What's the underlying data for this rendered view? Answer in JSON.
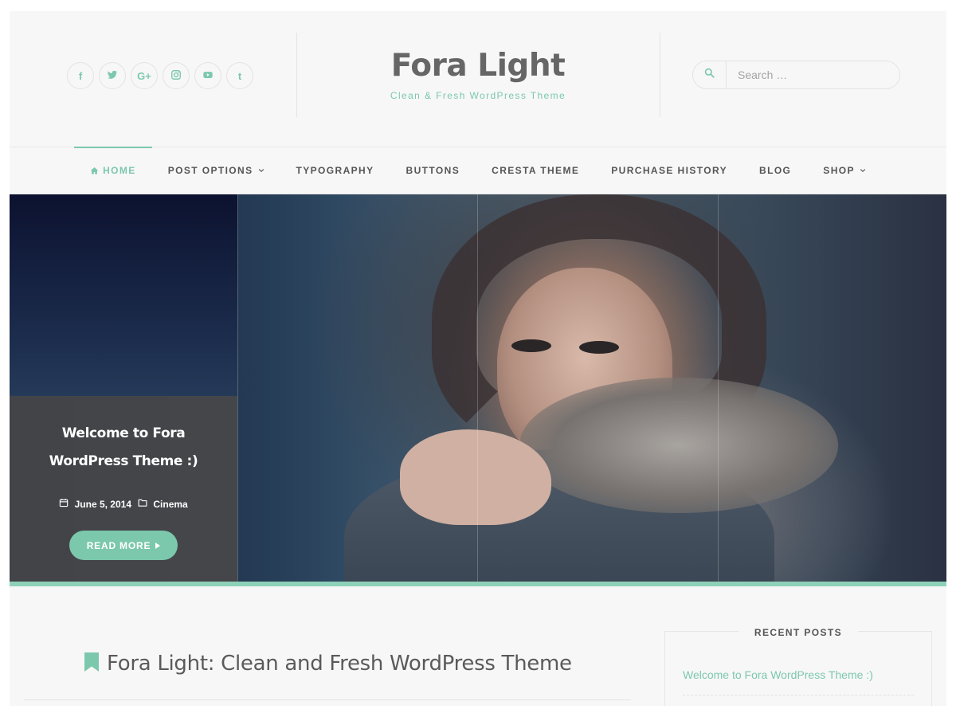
{
  "colors": {
    "accent": "#7cc8ad",
    "text": "#555555",
    "background": "#f7f7f7"
  },
  "header": {
    "social": [
      {
        "name": "facebook",
        "icon": "facebook-icon",
        "glyph": "f"
      },
      {
        "name": "twitter",
        "icon": "twitter-icon",
        "glyph": ""
      },
      {
        "name": "google-plus",
        "icon": "google-plus-icon",
        "glyph": "G+"
      },
      {
        "name": "instagram",
        "icon": "instagram-icon",
        "glyph": ""
      },
      {
        "name": "youtube",
        "icon": "youtube-icon",
        "glyph": ""
      },
      {
        "name": "tumblr",
        "icon": "tumblr-icon",
        "glyph": "t"
      }
    ],
    "site_title": "Fora Light",
    "tagline": "Clean & Fresh WordPress Theme",
    "search_placeholder": "Search …"
  },
  "nav": {
    "items": [
      {
        "label": "HOME",
        "active": true,
        "dropdown": false
      },
      {
        "label": "POST OPTIONS",
        "active": false,
        "dropdown": true
      },
      {
        "label": "TYPOGRAPHY",
        "active": false,
        "dropdown": false
      },
      {
        "label": "BUTTONS",
        "active": false,
        "dropdown": false
      },
      {
        "label": "CRESTA THEME",
        "active": false,
        "dropdown": false
      },
      {
        "label": "PURCHASE HISTORY",
        "active": false,
        "dropdown": false
      },
      {
        "label": "BLOG",
        "active": false,
        "dropdown": false
      },
      {
        "label": "SHOP",
        "active": false,
        "dropdown": true
      }
    ]
  },
  "hero": {
    "title": "Welcome to Fora WordPress Theme :)",
    "date": "June 5, 2014",
    "category": "Cinema",
    "button_label": "READ MORE"
  },
  "main": {
    "post_title": "Fora Light: Clean and Fresh WordPress Theme"
  },
  "sidebar": {
    "widget_title": "RECENT POSTS",
    "recent_posts": [
      "Welcome to Fora WordPress Theme :)"
    ]
  }
}
